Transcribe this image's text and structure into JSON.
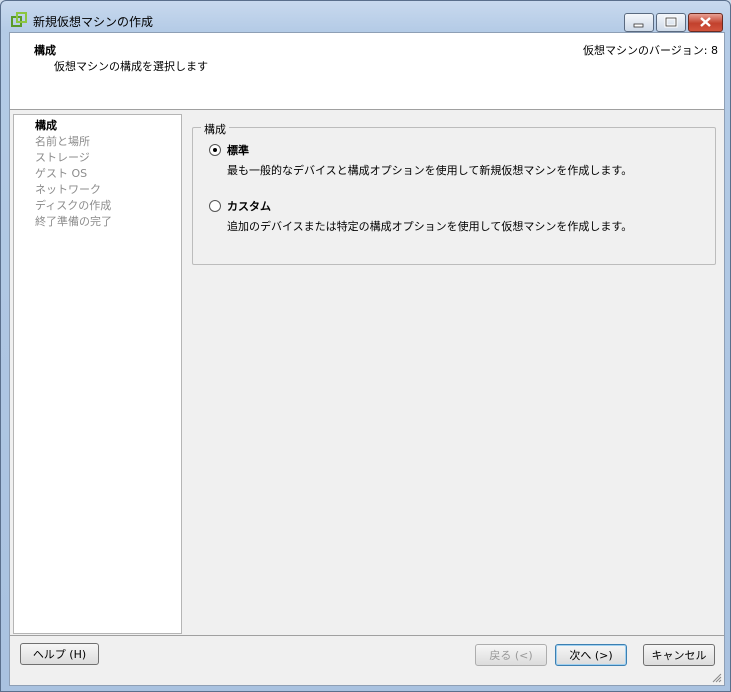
{
  "window": {
    "title": "新規仮想マシンの作成"
  },
  "header": {
    "title": "構成",
    "subtitle": "仮想マシンの構成を選択します",
    "version": "仮想マシンのバージョン: 8"
  },
  "sidebar": {
    "items": [
      {
        "label": "構成",
        "active": true
      },
      {
        "label": "名前と場所",
        "active": false
      },
      {
        "label": "ストレージ",
        "active": false
      },
      {
        "label": "ゲスト OS",
        "active": false
      },
      {
        "label": "ネットワーク",
        "active": false
      },
      {
        "label": "ディスクの作成",
        "active": false
      },
      {
        "label": "終了準備の完了",
        "active": false
      }
    ]
  },
  "config_group": {
    "legend": "構成",
    "options": [
      {
        "label": "標準",
        "description": "最も一般的なデバイスと構成オプションを使用して新規仮想マシンを作成します。",
        "selected": true
      },
      {
        "label": "カスタム",
        "description": "追加のデバイスまたは特定の構成オプションを使用して仮想マシンを作成します。",
        "selected": false
      }
    ]
  },
  "buttons": {
    "help": "ヘルプ (H)",
    "back": "戻る (<)",
    "next": "次へ (>)",
    "cancel": "キャンセル"
  },
  "colors": {
    "title_bar": "#b4cbe6",
    "close_button": "#c2412d",
    "panel_background": "#f0f0f0"
  }
}
